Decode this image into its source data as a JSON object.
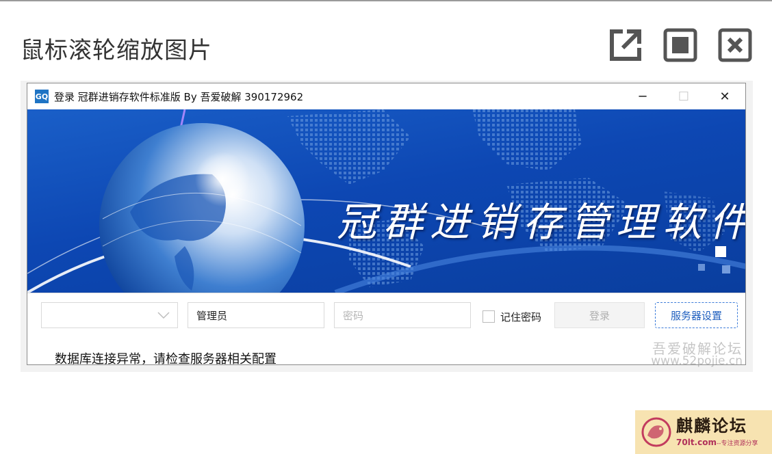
{
  "viewer": {
    "title": "鼠标滚轮缩放图片",
    "tools": [
      {
        "name": "open-external-icon"
      },
      {
        "name": "fit-screen-icon"
      },
      {
        "name": "close-icon"
      }
    ]
  },
  "window": {
    "icon_text": "GQ",
    "title": "登录 冠群进销存软件标准版  By 吾爱破解 390172962",
    "controls": {
      "minimize": "─",
      "maximize": "☐",
      "close": "✕"
    }
  },
  "banner": {
    "slogan": "冠群进销存管理软件"
  },
  "form": {
    "company_select_value": "",
    "username_value": "管理员",
    "password_placeholder": "密码",
    "remember_label": "记住密码",
    "login_label": "登录",
    "server_settings_label": "服务器设置"
  },
  "status_text": "数据库连接异常，请检查服务器相关配置",
  "watermark": {
    "line1": "吾爱破解论坛",
    "line2": "www.52pojie.cn"
  },
  "badge": {
    "name": "麒麟论坛",
    "url": "70lt.com",
    "tagline": "--专注资源分享"
  },
  "colors": {
    "banner_blue": "#0d47b3",
    "server_button_border": "#3b7bd9",
    "badge_bg": "#f7e3b1"
  }
}
